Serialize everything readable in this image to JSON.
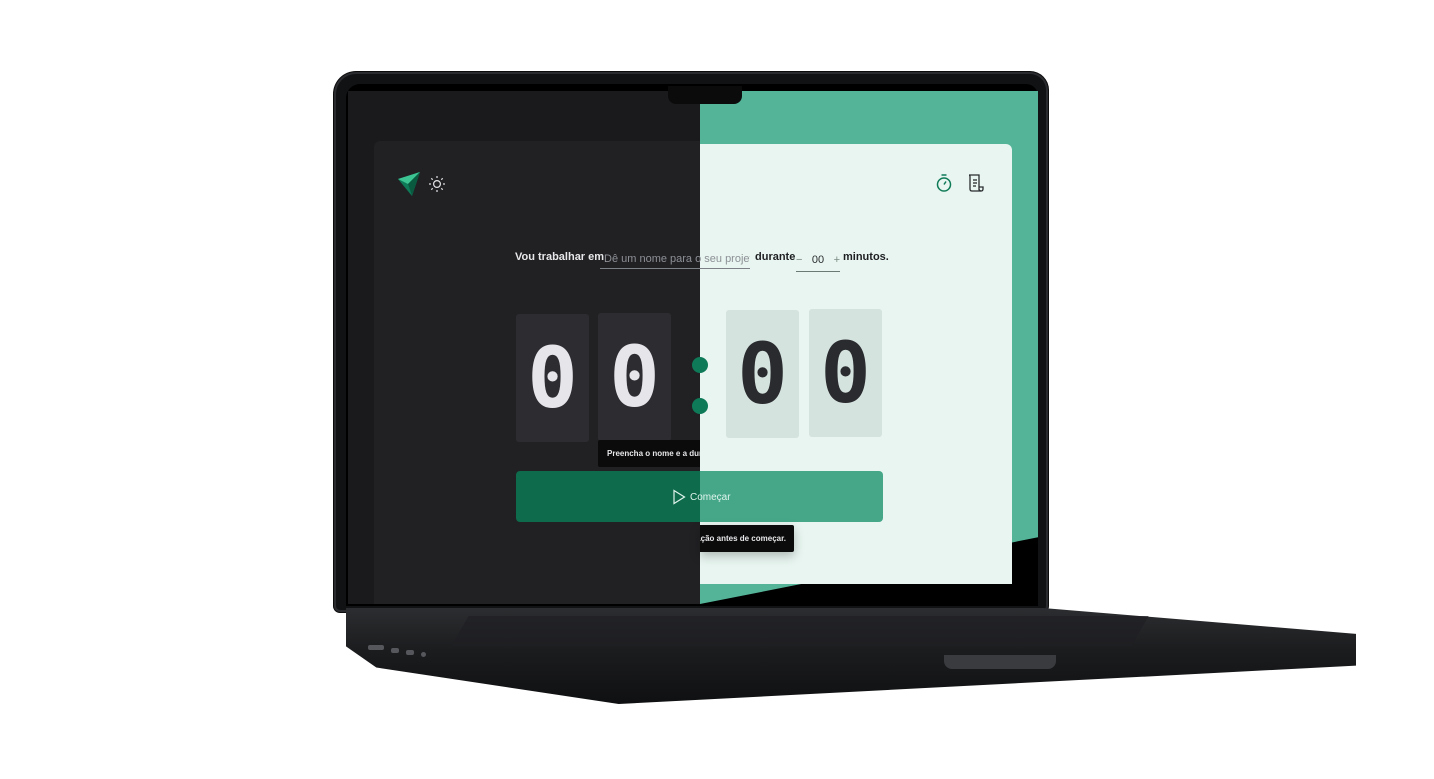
{
  "colors": {
    "accent": "#0f7a58",
    "accent_light": "#54b498",
    "dark_bg": "#212124",
    "light_bg": "#e8f5f0"
  },
  "header": {
    "logo": "logo-triangle-icon",
    "theme_toggle": "sun-icon",
    "timer_nav": "stopwatch-icon",
    "history_nav": "scroll-icon"
  },
  "form": {
    "prefix": "Vou trabalhar em",
    "project_placeholder": "Dê um nome para o seu projeto",
    "durante": "durante",
    "minus": "−",
    "minutes_value": "00",
    "plus": "+",
    "suffix": "minutos."
  },
  "countdown": {
    "min_tens": "0",
    "min_units": "0",
    "sec_tens": "0",
    "sec_units": "0"
  },
  "tooltip": {
    "left_part": "Preencha o nome e a dura",
    "right_part": "ação antes de começar."
  },
  "start_button": {
    "label": "Começar",
    "icon": "play-icon"
  }
}
